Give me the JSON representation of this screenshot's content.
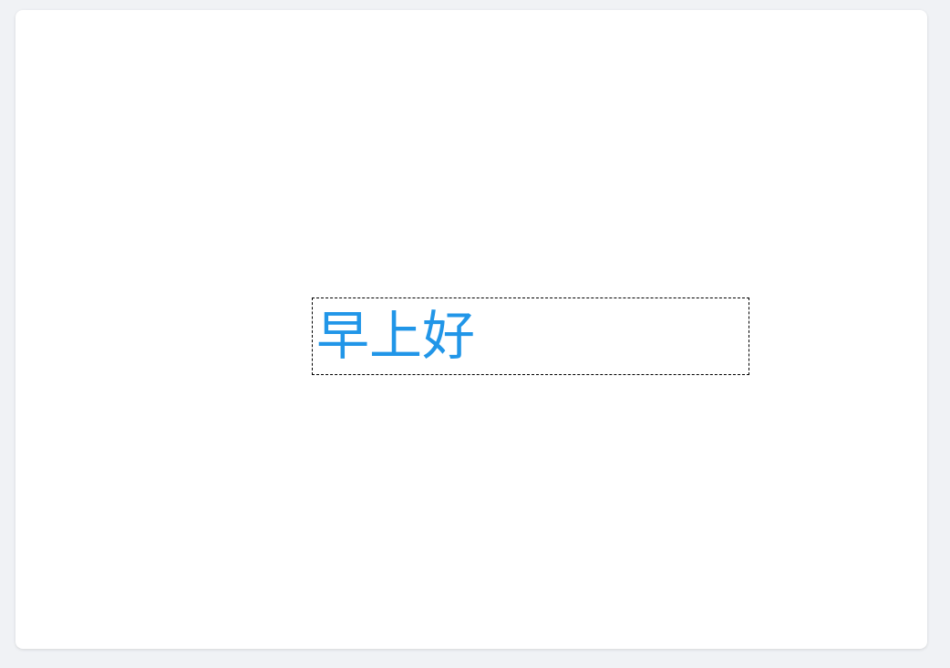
{
  "canvas": {
    "text_box": {
      "text": "早上好",
      "color": "#2196e8",
      "border_color": "#000000"
    }
  },
  "colors": {
    "page_background": "#f0f2f5",
    "card_background": "#ffffff"
  }
}
